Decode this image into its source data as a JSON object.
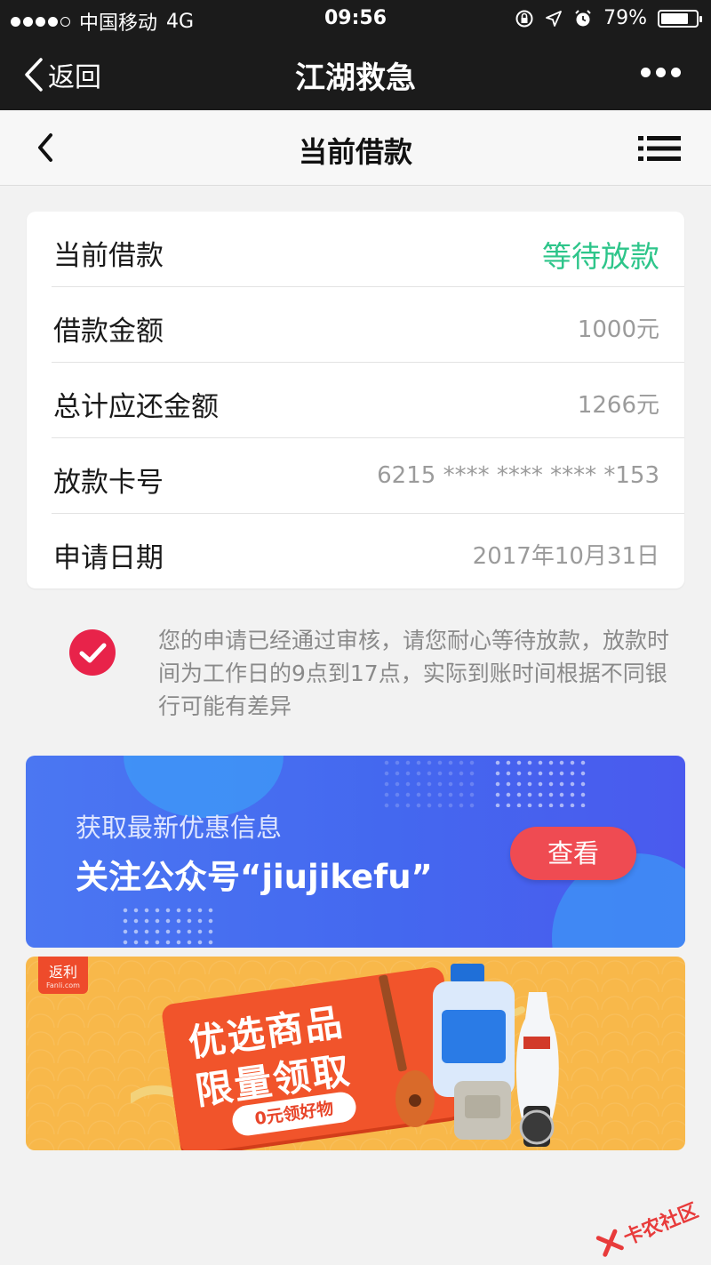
{
  "status_bar": {
    "carrier": "中国移动",
    "network": "4G",
    "time": "09:56",
    "battery": "79%"
  },
  "nav": {
    "back_label": "返回",
    "title": "江湖救急"
  },
  "page": {
    "title": "当前借款"
  },
  "loan": {
    "rows": [
      {
        "label": "当前借款",
        "value": "等待放款"
      },
      {
        "label": "借款金额",
        "value": "1000元"
      },
      {
        "label": "总计应还金额",
        "value": "1266元"
      },
      {
        "label": "放款卡号",
        "value": "6215 **** **** **** *153"
      },
      {
        "label": "申请日期",
        "value": "2017年10月31日"
      }
    ]
  },
  "notice": {
    "text": "您的申请已经通过审核，请您耐心等待放款，放款时间为工作日的9点到17点，实际到账时间根据不同银行可能有差异"
  },
  "banner_wechat": {
    "line1": "获取最新优惠信息",
    "line2": "关注公众号“jiujikefu”",
    "button": "查看"
  },
  "banner_promo": {
    "logo": "返利",
    "logo_sub": "Fanli.com",
    "title1": "优选商品",
    "title2": "限量领取",
    "pill": "0元领好物"
  },
  "watermark": "卡农社区",
  "colors": {
    "status_green": "#2dc58a",
    "check_red": "#e8234a",
    "banner_blue": "#4468ef",
    "banner_orange": "#f8b84a",
    "nav_dark": "#1b1b1b"
  }
}
